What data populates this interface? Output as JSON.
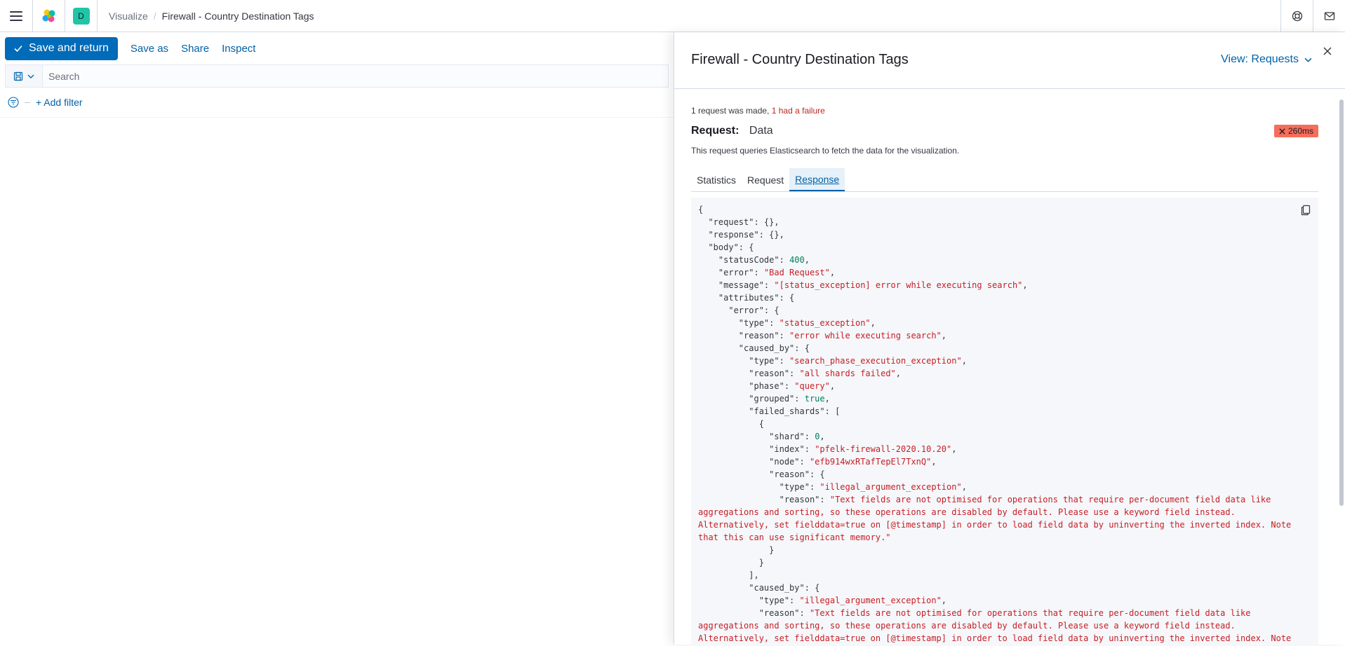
{
  "header": {
    "space_letter": "D",
    "breadcrumb_root": "Visualize",
    "breadcrumb_current": "Firewall - Country Destination Tags"
  },
  "toolbar": {
    "save_return": "Save and return",
    "save_as": "Save as",
    "share": "Share",
    "inspect": "Inspect"
  },
  "search": {
    "placeholder": "Search"
  },
  "filters": {
    "add_filter": "+ Add filter"
  },
  "flyout": {
    "title": "Firewall - Country Destination Tags",
    "view_label": "View: Requests",
    "summary_prefix": "1 request was made,",
    "summary_failure": "1 had a failure",
    "request_label": "Request:",
    "request_name": "Data",
    "duration": "260ms",
    "description": "This request queries Elasticsearch to fetch the data for the visualization.",
    "tabs": [
      "Statistics",
      "Request",
      "Response"
    ],
    "active_tab": "Response"
  },
  "response_lines": [
    [
      {
        "t": "{",
        "c": "k"
      }
    ],
    [
      {
        "t": "  \"request\": {},",
        "c": "k"
      }
    ],
    [
      {
        "t": "  \"response\": {},",
        "c": "k"
      }
    ],
    [
      {
        "t": "  \"body\": {",
        "c": "k"
      }
    ],
    [
      {
        "t": "    \"statusCode\": ",
        "c": "k"
      },
      {
        "t": "400",
        "c": "n"
      },
      {
        "t": ",",
        "c": "k"
      }
    ],
    [
      {
        "t": "    \"error\": ",
        "c": "k"
      },
      {
        "t": "\"Bad Request\"",
        "c": "s"
      },
      {
        "t": ",",
        "c": "k"
      }
    ],
    [
      {
        "t": "    \"message\": ",
        "c": "k"
      },
      {
        "t": "\"[status_exception] error while executing search\"",
        "c": "s"
      },
      {
        "t": ",",
        "c": "k"
      }
    ],
    [
      {
        "t": "    \"attributes\": {",
        "c": "k"
      }
    ],
    [
      {
        "t": "      \"error\": {",
        "c": "k"
      }
    ],
    [
      {
        "t": "        \"type\": ",
        "c": "k"
      },
      {
        "t": "\"status_exception\"",
        "c": "s"
      },
      {
        "t": ",",
        "c": "k"
      }
    ],
    [
      {
        "t": "        \"reason\": ",
        "c": "k"
      },
      {
        "t": "\"error while executing search\"",
        "c": "s"
      },
      {
        "t": ",",
        "c": "k"
      }
    ],
    [
      {
        "t": "        \"caused_by\": {",
        "c": "k"
      }
    ],
    [
      {
        "t": "          \"type\": ",
        "c": "k"
      },
      {
        "t": "\"search_phase_execution_exception\"",
        "c": "s"
      },
      {
        "t": ",",
        "c": "k"
      }
    ],
    [
      {
        "t": "          \"reason\": ",
        "c": "k"
      },
      {
        "t": "\"all shards failed\"",
        "c": "s"
      },
      {
        "t": ",",
        "c": "k"
      }
    ],
    [
      {
        "t": "          \"phase\": ",
        "c": "k"
      },
      {
        "t": "\"query\"",
        "c": "s"
      },
      {
        "t": ",",
        "c": "k"
      }
    ],
    [
      {
        "t": "          \"grouped\": ",
        "c": "k"
      },
      {
        "t": "true",
        "c": "n"
      },
      {
        "t": ",",
        "c": "k"
      }
    ],
    [
      {
        "t": "          \"failed_shards\": [",
        "c": "k"
      }
    ],
    [
      {
        "t": "            {",
        "c": "k"
      }
    ],
    [
      {
        "t": "              \"shard\": ",
        "c": "k"
      },
      {
        "t": "0",
        "c": "n"
      },
      {
        "t": ",",
        "c": "k"
      }
    ],
    [
      {
        "t": "              \"index\": ",
        "c": "k"
      },
      {
        "t": "\"pfelk-firewall-2020.10.20\"",
        "c": "s"
      },
      {
        "t": ",",
        "c": "k"
      }
    ],
    [
      {
        "t": "              \"node\": ",
        "c": "k"
      },
      {
        "t": "\"efb914wxRTafTepEl7TxnQ\"",
        "c": "s"
      },
      {
        "t": ",",
        "c": "k"
      }
    ],
    [
      {
        "t": "              \"reason\": {",
        "c": "k"
      }
    ],
    [
      {
        "t": "                \"type\": ",
        "c": "k"
      },
      {
        "t": "\"illegal_argument_exception\"",
        "c": "s"
      },
      {
        "t": ",",
        "c": "k"
      }
    ],
    [
      {
        "t": "                \"reason\": ",
        "c": "k"
      },
      {
        "t": "\"Text fields are not optimised for operations that require per-document field data like",
        "c": "s"
      }
    ],
    [
      {
        "t": "aggregations and sorting, so these operations are disabled by default. Please use a keyword field instead.",
        "c": "s"
      }
    ],
    [
      {
        "t": "Alternatively, set fielddata=true on [@timestamp] in order to load field data by uninverting the inverted index. Note",
        "c": "s"
      }
    ],
    [
      {
        "t": "that this can use significant memory.\"",
        "c": "s"
      }
    ],
    [
      {
        "t": "              }",
        "c": "k"
      }
    ],
    [
      {
        "t": "            }",
        "c": "k"
      }
    ],
    [
      {
        "t": "          ],",
        "c": "k"
      }
    ],
    [
      {
        "t": "          \"caused_by\": {",
        "c": "k"
      }
    ],
    [
      {
        "t": "            \"type\": ",
        "c": "k"
      },
      {
        "t": "\"illegal_argument_exception\"",
        "c": "s"
      },
      {
        "t": ",",
        "c": "k"
      }
    ],
    [
      {
        "t": "            \"reason\": ",
        "c": "k"
      },
      {
        "t": "\"Text fields are not optimised for operations that require per-document field data like",
        "c": "s"
      }
    ],
    [
      {
        "t": "aggregations and sorting, so these operations are disabled by default. Please use a keyword field instead.",
        "c": "s"
      }
    ],
    [
      {
        "t": "Alternatively, set fielddata=true on [@timestamp] in order to load field data by uninverting the inverted index. Note",
        "c": "s"
      }
    ]
  ],
  "icons": {
    "menu": "hamburger-icon",
    "logo": "elastic-logo",
    "help": "help-icon",
    "mail": "mail-icon",
    "check": "check-icon",
    "save": "save-icon",
    "filter": "filter-icon",
    "close": "close-icon",
    "copy": "copy-icon",
    "cross": "cross-icon"
  },
  "colors": {
    "primary": "#006bb8",
    "danger": "#bd271e",
    "badge": "#f66d5b",
    "space": "#20c5a8"
  }
}
